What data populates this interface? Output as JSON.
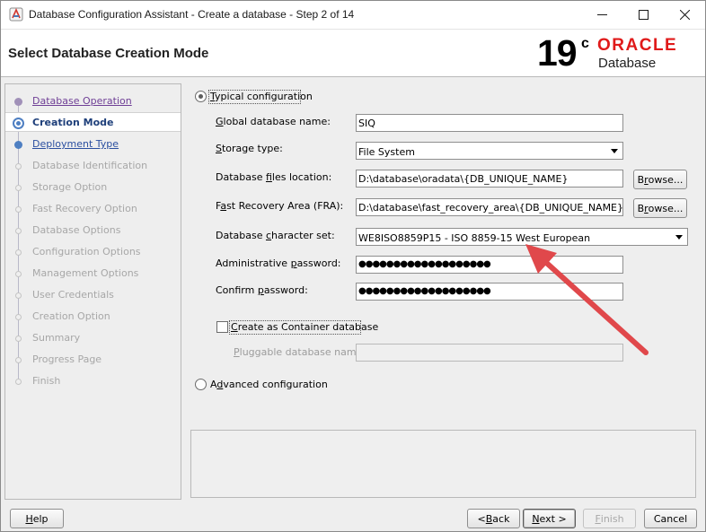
{
  "window": {
    "title": "Database Configuration Assistant - Create a database - Step 2 of 14",
    "icon": "dbca-app-icon",
    "controls": [
      "minimize-icon",
      "maximize-icon",
      "close-icon"
    ]
  },
  "header": {
    "title": "Select Database Creation Mode",
    "brand": {
      "version": "19",
      "version_sup": "c",
      "vendor": "ORACLE",
      "product": "Database",
      "vendor_color": "#e01a1a"
    }
  },
  "nav": {
    "items": [
      {
        "label": "Database Operation",
        "state": "done"
      },
      {
        "label": "Creation Mode",
        "state": "current"
      },
      {
        "label": "Deployment Type",
        "state": "next"
      },
      {
        "label": "Database Identification",
        "state": "disabled"
      },
      {
        "label": "Storage Option",
        "state": "disabled"
      },
      {
        "label": "Fast Recovery Option",
        "state": "disabled"
      },
      {
        "label": "Database Options",
        "state": "disabled"
      },
      {
        "label": "Configuration Options",
        "state": "disabled"
      },
      {
        "label": "Management Options",
        "state": "disabled"
      },
      {
        "label": "User Credentials",
        "state": "disabled"
      },
      {
        "label": "Creation Option",
        "state": "disabled"
      },
      {
        "label": "Summary",
        "state": "disabled"
      },
      {
        "label": "Progress Page",
        "state": "disabled"
      },
      {
        "label": "Finish",
        "state": "disabled"
      }
    ],
    "colors": {
      "current": "#1e3f7a",
      "done": "#6f3f96",
      "link": "#2b4fa0",
      "disabled": "#a7a7a7"
    }
  },
  "form": {
    "typical_label_mn": "T",
    "typical_label_rest": "ypical configuration",
    "typical_selected": true,
    "global_name_label": {
      "mn": "G",
      "rest": "lobal database name:"
    },
    "global_name_value": "SIQ",
    "storage_label": {
      "mn": "S",
      "rest": "torage type:"
    },
    "storage_value": "File System",
    "files_loc_label": {
      "pre": "Database ",
      "mn": "f",
      "rest": "iles location:"
    },
    "files_loc_value": "D:\\database\\oradata\\{DB_UNIQUE_NAME}",
    "fra_label": {
      "pre": "F",
      "mn": "a",
      "rest": "st Recovery Area (FRA):"
    },
    "fra_value": "D:\\database\\fast_recovery_area\\{DB_UNIQUE_NAME}",
    "browse_label": {
      "pre": "B",
      "mn": "r",
      "rest": "owse..."
    },
    "charset_label": {
      "pre": "Database ",
      "mn": "c",
      "rest": "haracter set:"
    },
    "charset_value": "WE8ISO8859P15 - ISO 8859-15 West European",
    "admin_pw_label": {
      "pre": "Administrative ",
      "mn": "p",
      "rest": "assword:"
    },
    "admin_pw_value": "●●●●●●●●●●●●●●●●●●●",
    "confirm_pw_label": {
      "pre": "Confirm ",
      "mn": "p",
      "rest": "assword:"
    },
    "confirm_pw_value": "●●●●●●●●●●●●●●●●●●●",
    "container_label": {
      "mn": "C",
      "rest": "reate as Container database"
    },
    "container_checked": false,
    "pdb_label": {
      "mn": "P",
      "rest": "luggable database name:"
    },
    "pdb_value": "",
    "advanced_label": {
      "pre": "A",
      "mn": "d",
      "rest": "vanced configuration"
    },
    "advanced_selected": false
  },
  "buttons": {
    "help": {
      "mn": "H",
      "rest": "elp"
    },
    "back": {
      "pre": "< ",
      "mn": "B",
      "rest": "ack"
    },
    "next": {
      "mn": "N",
      "rest": "ext >"
    },
    "finish": {
      "mn": "F",
      "rest": "inish"
    },
    "cancel": "Cancel"
  },
  "annotation": {
    "color": "#e0484b",
    "target": "charset-combo"
  }
}
